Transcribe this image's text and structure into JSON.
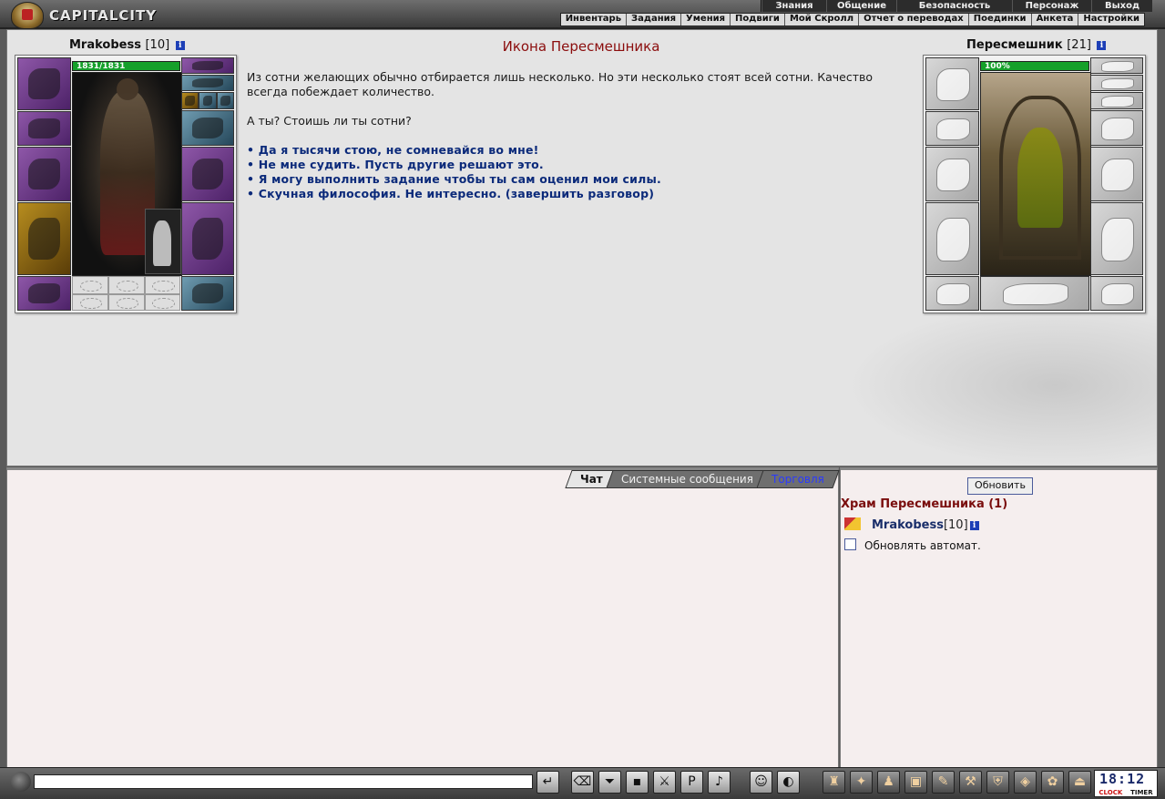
{
  "app": {
    "logo_text": "CAPITALCITY"
  },
  "top_menu": [
    {
      "label": "Знания",
      "w": 70
    },
    {
      "label": "Общение",
      "w": 76
    },
    {
      "label": "Безопасность",
      "w": 126
    },
    {
      "label": "Персонаж",
      "w": 86
    },
    {
      "label": "Выход",
      "w": 66
    }
  ],
  "sub_menu": [
    "Инвентарь",
    "Задания",
    "Умения",
    "Подвиги",
    "Мой Скролл",
    "Отчет о переводах",
    "Поединки",
    "Анкета",
    "Настройки"
  ],
  "player": {
    "name": "Mrakobess",
    "level": "[10]",
    "hp": "1831/1831",
    "info": "i"
  },
  "npc": {
    "name": "Пересмешник",
    "level": "[21]",
    "hp": "100%",
    "info": "i"
  },
  "dialog": {
    "title": "Икона Пересмешника",
    "text1": "Из сотни желающих обычно отбирается лишь несколько. Но эти несколько стоят всей сотни. Качество всегда побеждает количество.",
    "text2": "А ты? Стоишь ли ты сотни?",
    "options": [
      "• Да я тысячи стою, не сомневайся во мне!",
      "• Не мне судить. Пусть другие решают это.",
      "• Я могу выполнить задание чтобы ты сам оценил мои силы.",
      "• Скучная философия. Не интересно. (завершить разговор)"
    ]
  },
  "chat": {
    "tabs": [
      "Чат",
      "Системные сообщения",
      "Торговля"
    ]
  },
  "location": {
    "refresh_label": "Обновить",
    "name": "Храм Пересмешника (1)",
    "user_nick": "Mrakobess",
    "user_level": "[10]",
    "auto_label": "Обновлять автомат."
  },
  "bottom": {
    "icons": [
      "send-icon",
      "eraser-icon",
      "filter-icon",
      "save-icon",
      "fight-icon",
      "pl-icon",
      "sound-icon",
      "smile-icon",
      "helmet-icon"
    ],
    "right_icons": [
      "monk-icon",
      "fire-icon",
      "bag-icon",
      "treasure-icon",
      "scroll-icon",
      "gun-icon",
      "shield-icon",
      "gift-icon",
      "pets-icon",
      "exit-icon"
    ],
    "clock_time": "18:12",
    "clock_label": "CLOCK",
    "timer_label": "TIMER"
  }
}
